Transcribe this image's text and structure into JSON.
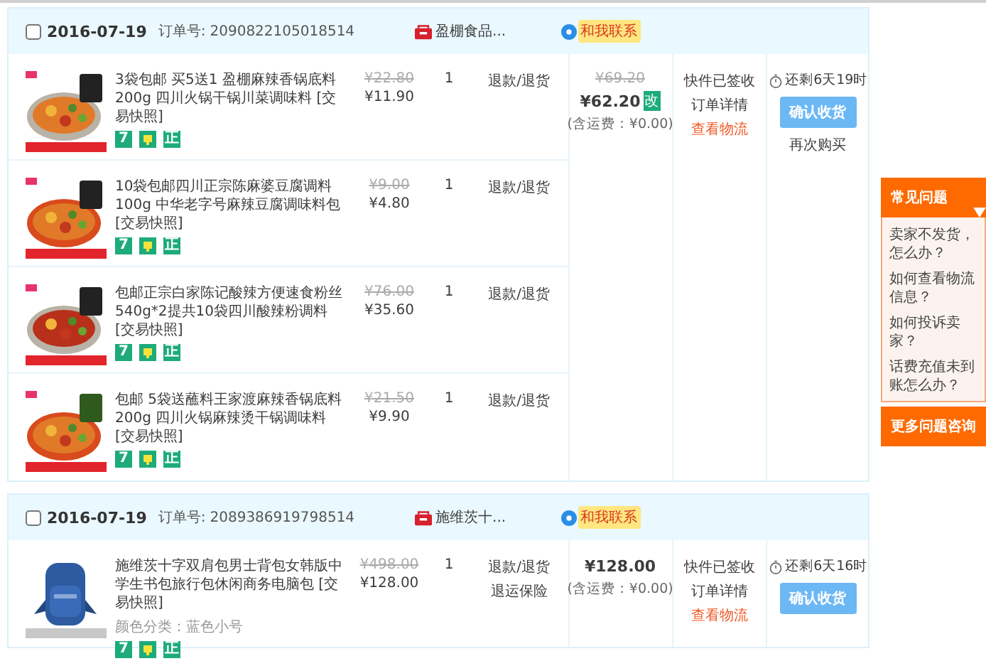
{
  "orders": [
    {
      "date": "2016-07-19",
      "checked": false,
      "order_label": "订单号:",
      "order_no": "2090822105018514",
      "shop": "盈棚食品...",
      "contact": "和我联系",
      "items": [
        {
          "title": "3袋包邮 买5送1 盈棚麻辣香锅底料200g 四川火锅干锅川菜调味料 [交易快照]",
          "tags": [
            {
              "kind": "text",
              "text": "7"
            },
            {
              "kind": "icon"
            },
            {
              "kind": "text",
              "text": "正"
            }
          ],
          "orig_price": "¥22.80",
          "price": "¥11.90",
          "qty": "1",
          "actions": [
            "退款/退货"
          ]
        },
        {
          "title": "10袋包邮四川正宗陈麻婆豆腐调料100g 中华老字号麻辣豆腐调味料包 [交易快照]",
          "tags": [
            {
              "kind": "text",
              "text": "7"
            },
            {
              "kind": "icon"
            },
            {
              "kind": "text",
              "text": "正"
            }
          ],
          "orig_price": "¥9.00",
          "price": "¥4.80",
          "qty": "1",
          "actions": [
            "退款/退货"
          ]
        },
        {
          "title": "包邮正宗白家陈记酸辣方便速食粉丝540g*2提共10袋四川酸辣粉调料 [交易快照]",
          "tags": [
            {
              "kind": "text",
              "text": "7"
            },
            {
              "kind": "icon"
            },
            {
              "kind": "text",
              "text": "正"
            }
          ],
          "orig_price": "¥76.00",
          "price": "¥35.60",
          "qty": "1",
          "actions": [
            "退款/退货"
          ]
        },
        {
          "title": "包邮 5袋送蘸料王家渡麻辣香锅底料200g 四川火锅麻辣烫干锅调味料 [交易快照]",
          "tags": [
            {
              "kind": "text",
              "text": "7"
            },
            {
              "kind": "icon"
            },
            {
              "kind": "text",
              "text": "正"
            }
          ],
          "orig_price": "¥21.50",
          "price": "¥9.90",
          "qty": "1",
          "actions": [
            "退款/退货"
          ]
        }
      ],
      "total": {
        "orig": "¥69.20",
        "price": "¥62.20",
        "badge": "改",
        "shipping": "(含运费：¥0.00)"
      },
      "status": [
        {
          "kind": "text",
          "text": "快件已签收"
        },
        {
          "kind": "text",
          "text": "订单详情"
        },
        {
          "kind": "link",
          "text": "查看物流"
        }
      ],
      "time_left": "还剩6天19时",
      "confirm": "确认收货",
      "rebuy": "再次购买"
    },
    {
      "date": "2016-07-19",
      "checked": false,
      "order_label": "订单号:",
      "order_no": "2089386919798514",
      "shop": "施维茨十...",
      "contact": "和我联系",
      "items": [
        {
          "title": "施维茨十字双肩包男士背包女韩版中学生书包旅行包休闲商务电脑包 [交易快照]",
          "spec": "颜色分类：蓝色小号",
          "tags": [
            {
              "kind": "text",
              "text": "7"
            },
            {
              "kind": "icon"
            },
            {
              "kind": "text",
              "text": "正"
            }
          ],
          "orig_price": "¥498.00",
          "price": "¥128.00",
          "qty": "1",
          "actions": [
            "退款/退货",
            "退运保险"
          ]
        }
      ],
      "total": {
        "price": "¥128.00",
        "shipping": "(含运费：¥0.00)"
      },
      "status": [
        {
          "kind": "text",
          "text": "快件已签收"
        },
        {
          "kind": "text",
          "text": "订单详情"
        },
        {
          "kind": "link",
          "text": "查看物流"
        }
      ],
      "time_left": "还剩6天16时",
      "confirm": "确认收货"
    }
  ],
  "faq": {
    "title": "常见问题",
    "items": [
      "卖家不发货，怎么办？",
      "如何查看物流信息？",
      "如何投诉卖家？",
      "话费充值未到账怎么办？"
    ],
    "more": "更多问题咨询"
  }
}
